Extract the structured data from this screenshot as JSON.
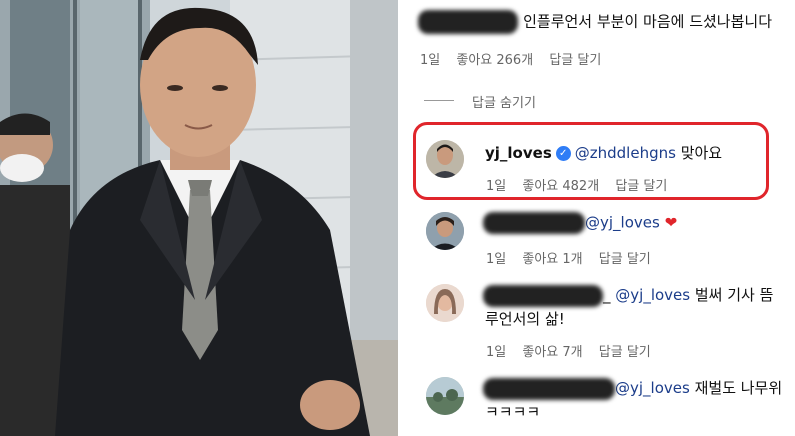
{
  "top_comment": {
    "text": "인플루언서 부분이 마음에 드셨나봅니다",
    "time": "1일",
    "likes": "좋아요 266개",
    "reply": "답글 달기"
  },
  "hide_replies": "답글 숨기기",
  "highlighted": {
    "username": "yj_loves",
    "mention": "@zhddlehgns",
    "text": "맞아요",
    "time": "1일",
    "likes": "좋아요 482개",
    "reply": "답글 달기"
  },
  "reply1": {
    "mention": "@yj_loves",
    "heart": "❤",
    "time": "1일",
    "likes": "좋아요 1개",
    "reply": "답글 달기"
  },
  "reply2": {
    "suffix": "_",
    "mention": "@yj_loves",
    "text": "벌써 기사 뜸",
    "line2": "루언서의 삶!",
    "time": "1일",
    "likes": "좋아요 7개",
    "reply": "답글 달기"
  },
  "reply3": {
    "mention": "@yj_loves",
    "text": "재벌도 나무위",
    "line2": "ㅋㅋㅋㅋ"
  },
  "colors": {
    "highlight": "#e0252b",
    "verified": "#2f7df6",
    "mention": "#1c3d8a"
  }
}
